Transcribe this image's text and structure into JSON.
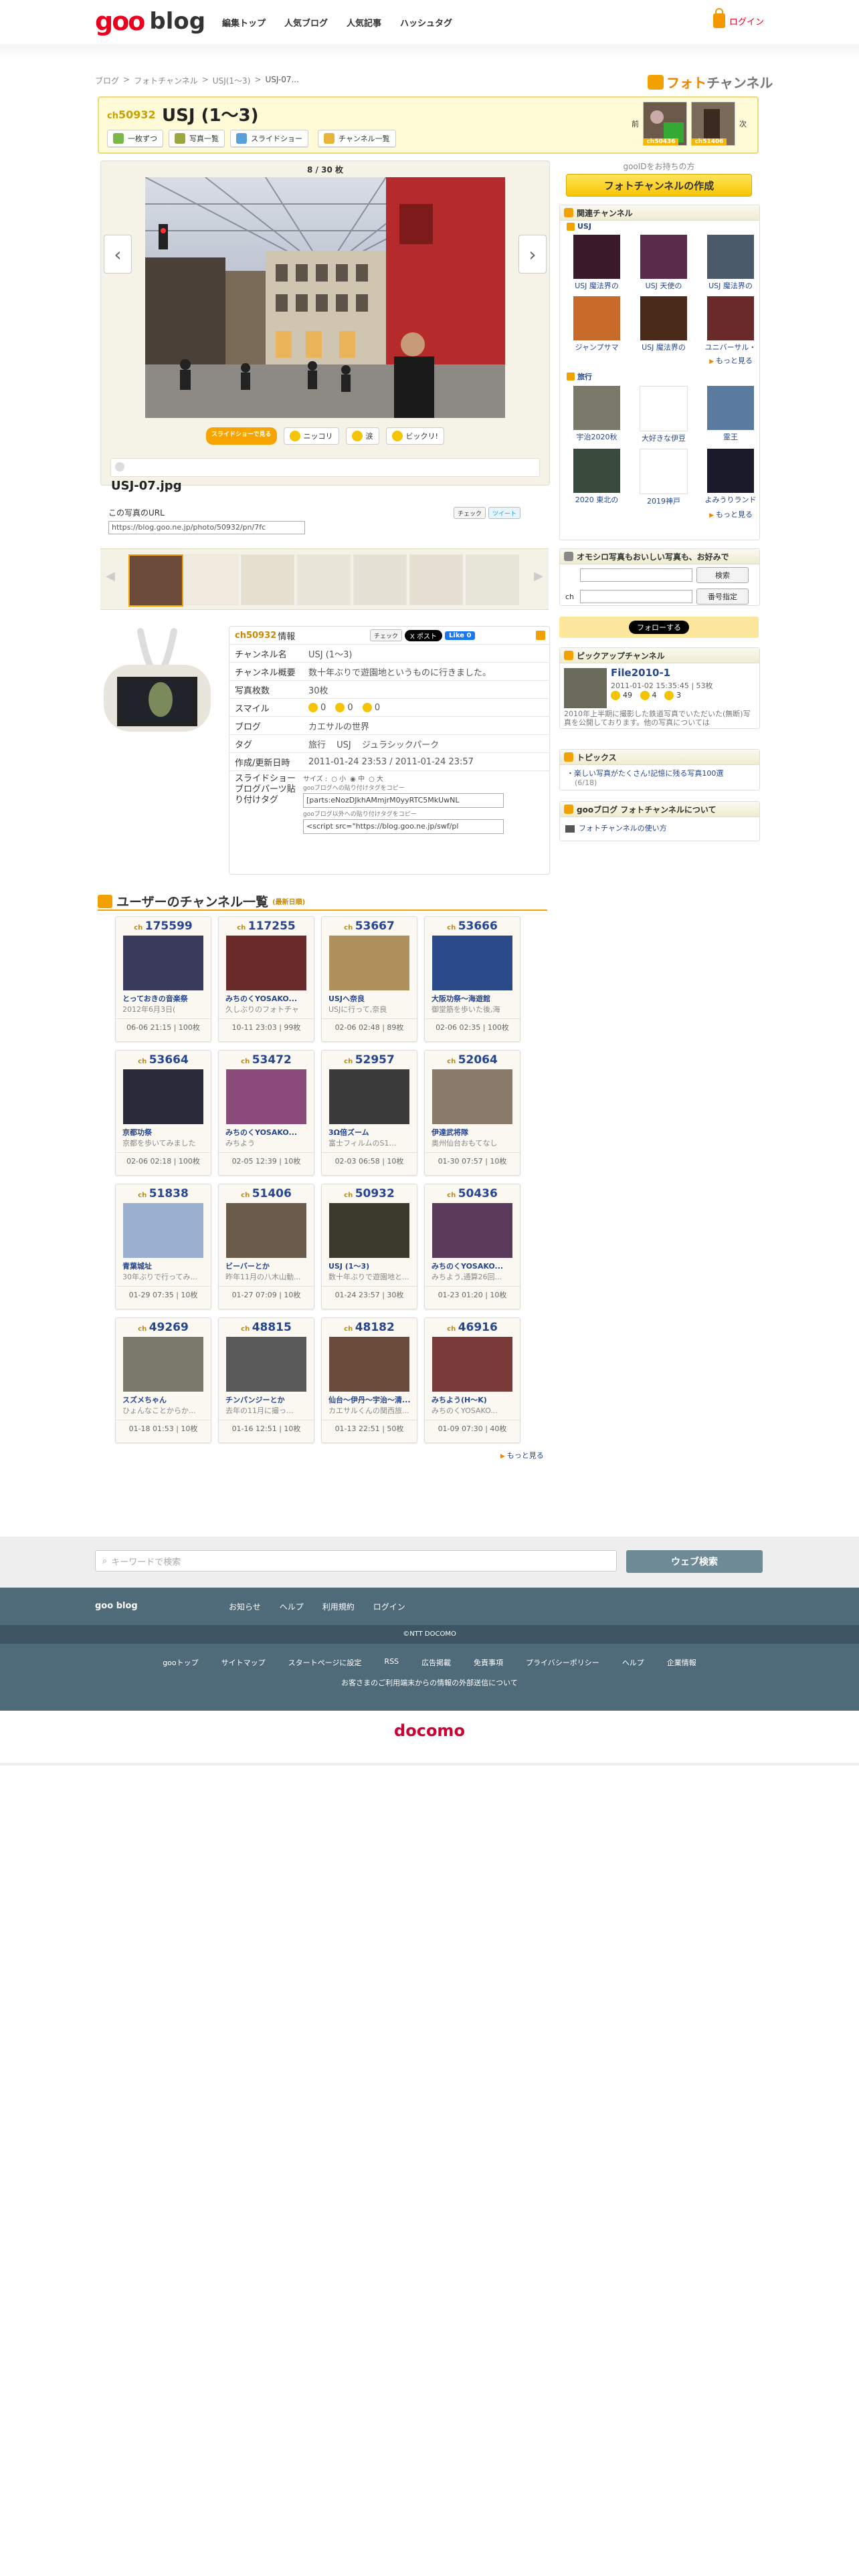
{
  "header": {
    "logo_goo": "goo",
    "logo_blog": "blog",
    "nav": [
      "編集トップ",
      "人気ブログ",
      "人気記事",
      "ハッシュタグ"
    ],
    "login": "ログイン"
  },
  "breadcrumb": [
    "ブログ",
    "フォトチャンネル",
    "USJ(1〜3)",
    "USJ-07..."
  ],
  "photo_channel_logo": {
    "part1": "フォト",
    "part2": "チャンネル"
  },
  "channel": {
    "prefix": "ch",
    "number": "50932",
    "title": "USJ (1〜3)",
    "tools": [
      "一枚ずつ",
      "写真一覧",
      "スライドショー",
      "チャンネル一覧"
    ],
    "prev_label": "前",
    "next_label": "次",
    "prev_tag": "ch50436",
    "next_tag": "ch51406"
  },
  "photo": {
    "counter": "8 / 30 枚",
    "reactions": [
      "スライドショーで見る",
      "ニッコリ",
      "涙",
      "ビックリ!"
    ],
    "filename": "USJ-07.jpg",
    "url_label": "この写真のURL",
    "url": "https://blog.goo.ne.jp/photo/50932/pn/7fc",
    "share": [
      "チェック",
      "ツイート"
    ]
  },
  "info": {
    "prefix": "ch",
    "number": "50932",
    "heading": "情報",
    "social": [
      "チェック",
      "X ポスト",
      "Like 0"
    ],
    "rows": [
      {
        "k": "チャンネル名",
        "v": "USJ (1〜3)"
      },
      {
        "k": "チャンネル概要",
        "v": "数十年ぶりで遊園地というものに行きました。"
      },
      {
        "k": "写真枚数",
        "v": "30枚"
      },
      {
        "k": "スマイル",
        "v": ""
      },
      {
        "k": "ブログ",
        "v": "カエサルの世界"
      },
      {
        "k": "タグ",
        "v": ""
      },
      {
        "k": "作成/更新日時",
        "v": "2011-01-24 23:53 / 2011-01-24 23:57"
      },
      {
        "k": "スライドショーブログパーツ貼り付けタグ",
        "v": ""
      }
    ],
    "smiles": [
      "0",
      "0",
      "0"
    ],
    "tags": [
      "旅行",
      "USJ",
      "ジュラシックパーク"
    ],
    "slide_size_label": "サイズ :",
    "slide_sizes": [
      "小",
      "中",
      "大"
    ],
    "code_caption1": "gooブログへの貼り付けタグをコピー",
    "code1": "[parts:eNozDJkhAMmjrM0yyRTC5MkUwNL",
    "code_caption2": "gooブログ以外への貼り付けタグをコピー",
    "code2": "<script src=\"https://blog.goo.ne.jp/swf/pl"
  },
  "sidebar": {
    "make_caption": "gooIDをお持ちの方",
    "make_button": "フォトチャンネルの作成",
    "related_title": "関連チャンネル",
    "related_groups": [
      {
        "name": "USJ",
        "items": [
          "USJ 魔法界の",
          "USJ 天使の",
          "USJ 魔法界の",
          "ジャンプサマ",
          "USJ 魔法界の",
          "ユニバーサル・"
        ]
      },
      {
        "name": "旅行",
        "items": [
          "宇治2020秋",
          "大好きな伊豆",
          "霊王",
          "2020 東北の",
          "2019神戸",
          "よみうりランド"
        ]
      }
    ],
    "more": "もっと見る",
    "search_title": "オモシロ写真もおいしい写真も、お好みで",
    "search_btn": "検索",
    "search_ch": "ch",
    "search_no_btn": "番号指定",
    "follow": "フォローする",
    "pickup_title": "ピックアップチャンネル",
    "pickup_name": "File2010-1",
    "pickup_meta": "2011-01-02 15:35:45 | 53枚",
    "pickup_smiles": [
      "49",
      "4",
      "3"
    ],
    "pickup_desc": "2010年上半期に撮影した鉄道写真でいただいた(無断)写真を公開しております。他の写真については",
    "topics_title": "トピックス",
    "topics_item": "楽しい写真がたくさん!記憶に残る写真100選",
    "topics_date": "(6/18)",
    "about_title": "gooブログ フォトチャンネルについて",
    "about_item": "フォトチャンネルの使い方"
  },
  "user_channels": {
    "title": "ユーザーのチャンネル一覧",
    "subtitle": "(最新日順)",
    "more": "もっと見る",
    "cards": [
      {
        "no": "175599",
        "title": "とっておきの音楽祭",
        "desc": "2012年6月3日(",
        "meta": "06-06 21:15 | 100枚"
      },
      {
        "no": "117255",
        "title": "みちのくYOSAKO...",
        "desc": "久しぶりのフォトチャ",
        "meta": "10-11 23:03 | 99枚"
      },
      {
        "no": "53667",
        "title": "USJへ奈良",
        "desc": "USJに行って,奈良",
        "meta": "02-06 02:48 | 89枚"
      },
      {
        "no": "53666",
        "title": "大阪功祭〜海遊館",
        "desc": "御堂筋を歩いた後,海",
        "meta": "02-06 02:35 | 100枚"
      },
      {
        "no": "53664",
        "title": "京都功祭",
        "desc": "京都を歩いてみました",
        "meta": "02-06 02:18 | 100枚"
      },
      {
        "no": "53472",
        "title": "みちのくYOSAKO...",
        "desc": "みちよう",
        "meta": "02-05 12:39 | 10枚"
      },
      {
        "no": "52957",
        "title": "3Ω倍ズーム",
        "desc": "富士フィルムのS1…",
        "meta": "02-03 06:58 | 10枚"
      },
      {
        "no": "52064",
        "title": "伊達武将隊",
        "desc": "奥州仙台おもてなし",
        "meta": "01-30 07:57 | 10枚"
      },
      {
        "no": "51838",
        "title": "青葉城址",
        "desc": "30年ぶりで行ってみ...",
        "meta": "01-29 07:35 | 10枚"
      },
      {
        "no": "51406",
        "title": "ビーバーとか",
        "desc": "昨年11月の八木山動...",
        "meta": "01-27 07:09 | 10枚"
      },
      {
        "no": "50932",
        "title": "USJ (1〜3)",
        "desc": "数十年ぶりで遊園地と...",
        "meta": "01-24 23:57 | 30枚"
      },
      {
        "no": "50436",
        "title": "みちのくYOSAKO...",
        "desc": "みちよう,通算26回...",
        "meta": "01-23 01:20 | 10枚"
      },
      {
        "no": "49269",
        "title": "スズメちゃん",
        "desc": "ひょんなことからか...",
        "meta": "01-18 01:53 | 10枚"
      },
      {
        "no": "48815",
        "title": "チンパンジーとか",
        "desc": "去年の11月に撮っ...",
        "meta": "01-16 12:51 | 10枚"
      },
      {
        "no": "48182",
        "title": "仙台〜伊丹〜宇治〜清...",
        "desc": "カエサルくんの関西旅...",
        "meta": "01-13 22:51 | 50枚"
      },
      {
        "no": "46916",
        "title": "みちよう(H〜K)",
        "desc": "みちのくYOSAKO...",
        "meta": "01-09 07:30 | 40枚"
      }
    ]
  },
  "footer": {
    "search_placeholder": "キーワードで検索",
    "search_button": "ウェブ検索",
    "brand": "goo blog",
    "nav": [
      "お知らせ",
      "ヘルプ",
      "利用規約",
      "ログイン"
    ],
    "copyright": "©NTT DOCOMO",
    "links": [
      "gooトップ",
      "サイトマップ",
      "スタートページに設定",
      "RSS",
      "広告掲載",
      "免責事項",
      "プライバシーポリシー",
      "ヘルプ",
      "企業情報"
    ],
    "notice": "お客さまのご利用端末からの情報の外部送信について",
    "docomo": "docomo"
  }
}
